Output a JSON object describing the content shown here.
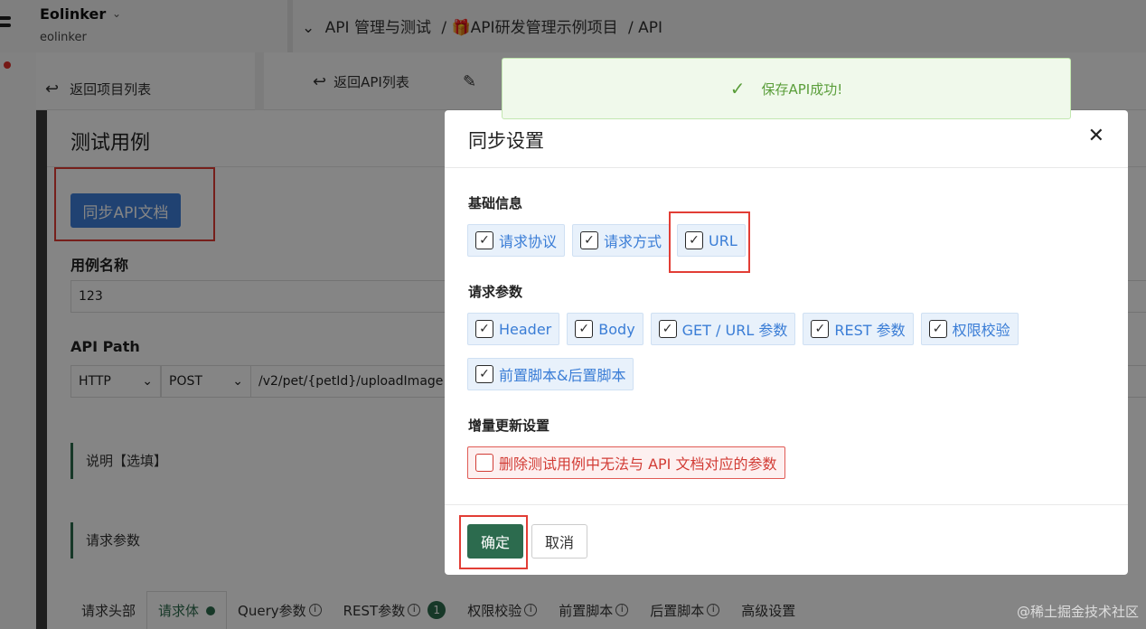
{
  "app": {
    "brand": "Eolinker",
    "workspace": "eolinker"
  },
  "breadcrumb": {
    "section": "API 管理与测试",
    "project": "/ 🎁API研发管理示例项目",
    "leaf": "/ API"
  },
  "subbar": {
    "back_project": "返回项目列表",
    "back_api": "返回API列表"
  },
  "panel": {
    "title": "测试用例",
    "sync_button": "同步API文档",
    "case_name_label": "用例名称",
    "case_name_value": "123",
    "api_path_label": "API Path",
    "protocol": "HTTP",
    "method": "POST",
    "path": "/v2/pet/{petId}/uploadImage",
    "note_section": "说明【选填】",
    "params_section": "请求参数",
    "tabs": [
      {
        "label": "请求头部"
      },
      {
        "label": "请求体"
      },
      {
        "label": "Query参数"
      },
      {
        "label": "REST参数",
        "badge": "1"
      },
      {
        "label": "权限校验"
      },
      {
        "label": "前置脚本"
      },
      {
        "label": "后置脚本"
      },
      {
        "label": "高级设置"
      }
    ]
  },
  "toast": {
    "message": "保存API成功!",
    "color": "#5a9e3a"
  },
  "modal": {
    "title": "同步设置",
    "basic_group": "基础信息",
    "basic_items": [
      "请求协议",
      "请求方式",
      "URL"
    ],
    "params_group": "请求参数",
    "params_items": [
      "Header",
      "Body",
      "GET / URL 参数",
      "REST 参数",
      "权限校验",
      "前置脚本&后置脚本"
    ],
    "incremental_group": "增量更新设置",
    "incremental_item": "删除测试用例中无法与 API 文档对应的参数",
    "confirm_button": "确定",
    "cancel_button": "取消"
  },
  "watermark": "@稀土掘金技术社区",
  "colors": {
    "primary_green": "#2c6b4e",
    "sync_blue": "#3f7fdb",
    "highlight_red": "#e23d35",
    "chip_blue": "#3a7dd6"
  },
  "icons": [
    "chevron-down-icon",
    "back-arrow-icon",
    "edit-icon",
    "check-icon",
    "close-icon",
    "checkbox-checked-icon",
    "checkbox-unchecked-icon",
    "info-icon"
  ]
}
